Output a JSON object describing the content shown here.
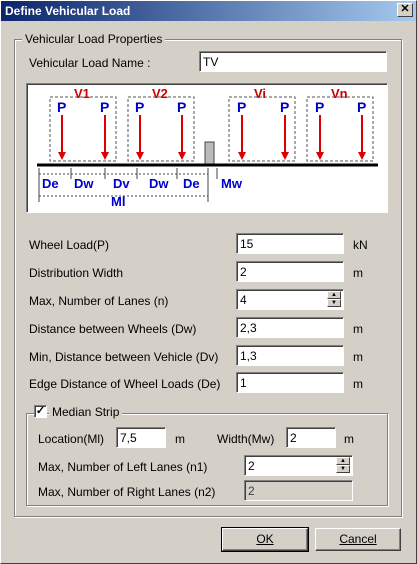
{
  "window": {
    "title": "Define Vehicular Load",
    "close_glyph": "✕"
  },
  "props": {
    "legend": "Vehicular Load Properties",
    "name_label": "Vehicular Load Name :",
    "name_value": "TV",
    "rows": [
      {
        "key": "wheel_load",
        "label": "Wheel Load(P)",
        "value": "15",
        "unit": "kN"
      },
      {
        "key": "dist_width",
        "label": "Distribution Width",
        "value": "2",
        "unit": "m"
      },
      {
        "key": "max_lanes",
        "label": "Max, Number of Lanes (n)",
        "value": "4",
        "unit": ""
      },
      {
        "key": "dist_wheels",
        "label": "Distance between Wheels (Dw)",
        "value": "2,3",
        "unit": "m"
      },
      {
        "key": "min_dist_vehicle",
        "label": "Min, Distance between Vehicle (Dv)",
        "value": "1,3",
        "unit": "m"
      },
      {
        "key": "edge_dist",
        "label": "Edge Distance of Wheel Loads (De)",
        "value": "1",
        "unit": "m"
      }
    ]
  },
  "diagram": {
    "vehicles": [
      "V1",
      "V2",
      "Vi",
      "Vn"
    ],
    "wheel_label": "P",
    "dims": [
      "De",
      "Dw",
      "Dv",
      "Dw",
      "De",
      "Mw"
    ],
    "ml_label": "Ml"
  },
  "median": {
    "legend": "Median Strip",
    "checked": true,
    "check_glyph": "✓",
    "location_label": "Location(Ml)",
    "location_value": "7,5",
    "location_unit": "m",
    "width_label": "Width(Mw)",
    "width_value": "2",
    "width_unit": "m",
    "left_lanes_label": "Max, Number of Left Lanes (n1)",
    "left_lanes_value": "2",
    "right_lanes_label": "Max, Number of Right Lanes (n2)",
    "right_lanes_value": "2"
  },
  "buttons": {
    "ok": "OK",
    "cancel": "Cancel"
  },
  "colors": {
    "vehicle_label": "#cc0000",
    "wheel_label": "#0000cc",
    "dim_label": "#0000cc",
    "arrow": "#dd0000"
  }
}
